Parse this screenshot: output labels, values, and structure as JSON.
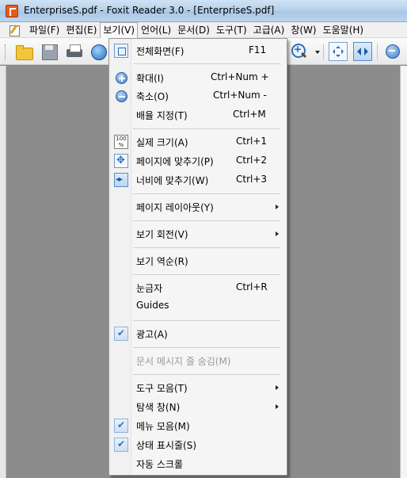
{
  "window": {
    "title": "EnterpriseS.pdf - Foxit Reader 3.0 - [EnterpriseS.pdf]"
  },
  "menubar": {
    "items": [
      {
        "label": "파일(F)"
      },
      {
        "label": "편집(E)"
      },
      {
        "label": "보기(V)"
      },
      {
        "label": "언어(L)"
      },
      {
        "label": "문서(D)"
      },
      {
        "label": "도구(T)"
      },
      {
        "label": "고급(A)"
      },
      {
        "label": "창(W)"
      },
      {
        "label": "도움말(H)"
      }
    ]
  },
  "toolbar": {
    "buttons": [
      "open-folder-icon",
      "save-icon",
      "print-icon",
      "globe-icon",
      "zoom-in-icon",
      "fit-page-icon",
      "fit-width-icon",
      "zoom-out-icon"
    ]
  },
  "view_menu": {
    "items": [
      {
        "label": "전체화면(F)",
        "shortcut": "F11",
        "icon": "fullscreen-icon"
      },
      {
        "label": "확대(I)",
        "shortcut": "Ctrl+Num +",
        "icon": "zoom-in-icon"
      },
      {
        "label": "축소(O)",
        "shortcut": "Ctrl+Num -",
        "icon": "zoom-out-icon"
      },
      {
        "label": "배율 지정(T)",
        "shortcut": "Ctrl+M"
      },
      {
        "label": "실제 크기(A)",
        "shortcut": "Ctrl+1",
        "icon": "actual-size-icon",
        "icon_text": "100 %"
      },
      {
        "label": "페이지에 맞추기(P)",
        "shortcut": "Ctrl+2",
        "icon": "fit-page-icon"
      },
      {
        "label": "너비에 맞추기(W)",
        "shortcut": "Ctrl+3",
        "icon": "fit-width-icon"
      },
      {
        "label": "페이지 레이아웃(Y)",
        "submenu": true
      },
      {
        "label": "보기 회전(V)",
        "submenu": true
      },
      {
        "label": "보기 역순(R)"
      },
      {
        "label": "눈금자",
        "shortcut": "Ctrl+R"
      },
      {
        "label": "Guides"
      },
      {
        "label": "광고(A)",
        "checked": true
      },
      {
        "label": "문서 메시지 줄 숨김(M)",
        "disabled": true
      },
      {
        "label": "도구 모음(T)",
        "submenu": true
      },
      {
        "label": "탐색 창(N)",
        "submenu": true
      },
      {
        "label": "메뉴 모음(M)",
        "checked": true
      },
      {
        "label": "상태 표시줄(S)",
        "checked": true
      },
      {
        "label": "자동 스크롤"
      }
    ]
  }
}
